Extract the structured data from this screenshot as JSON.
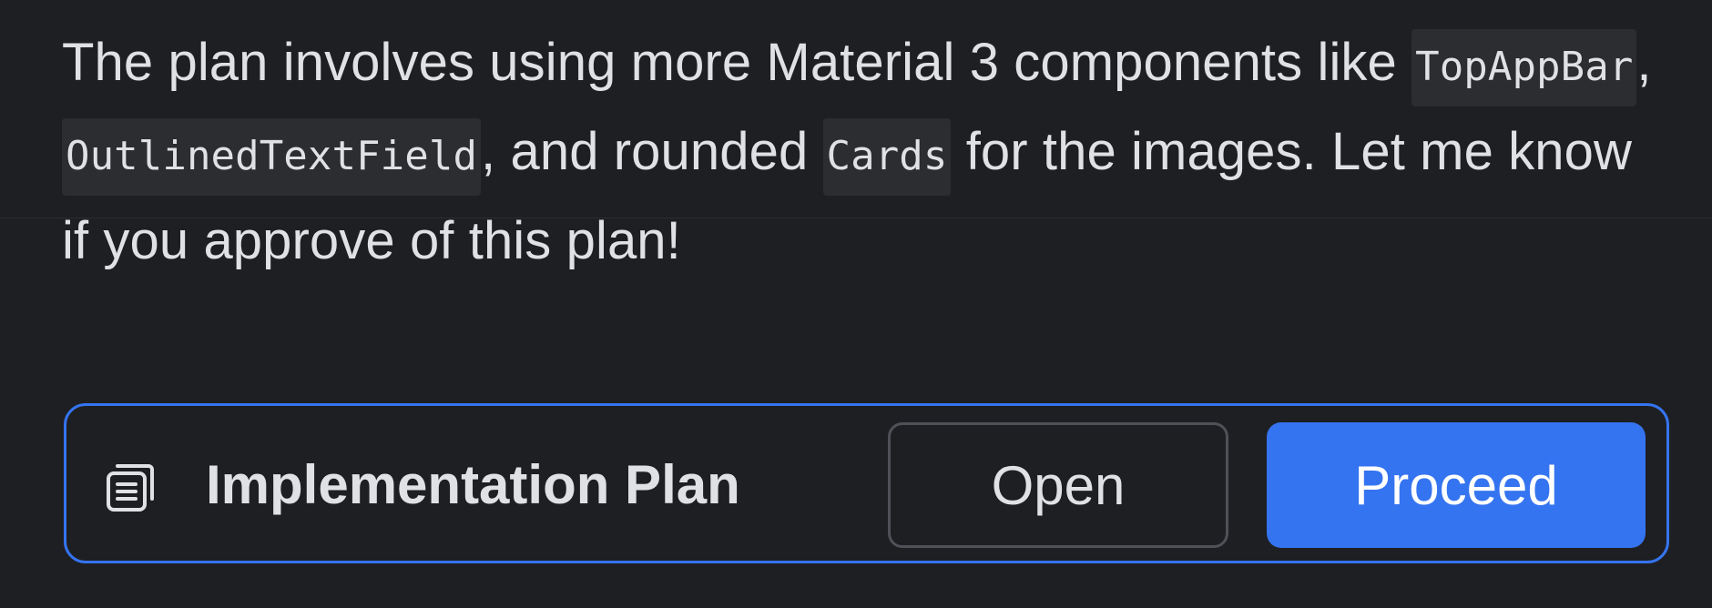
{
  "message": {
    "part1": "The plan involves using more Material 3 components like ",
    "code1": "TopAppBar",
    "part2": ", ",
    "code2": "OutlinedTextField",
    "part3": ", and rounded ",
    "code3": "Cards",
    "part4": " for the images. Let me know if you approve of this plan!"
  },
  "plan_bar": {
    "icon": "document-icon",
    "title": "Implementation Plan",
    "open_label": "Open",
    "proceed_label": "Proceed"
  },
  "colors": {
    "background": "#1e1f22",
    "accent": "#3574f0",
    "text": "#dfe1e5",
    "code_background": "#2c2d31",
    "button_border": "#4e5157"
  }
}
